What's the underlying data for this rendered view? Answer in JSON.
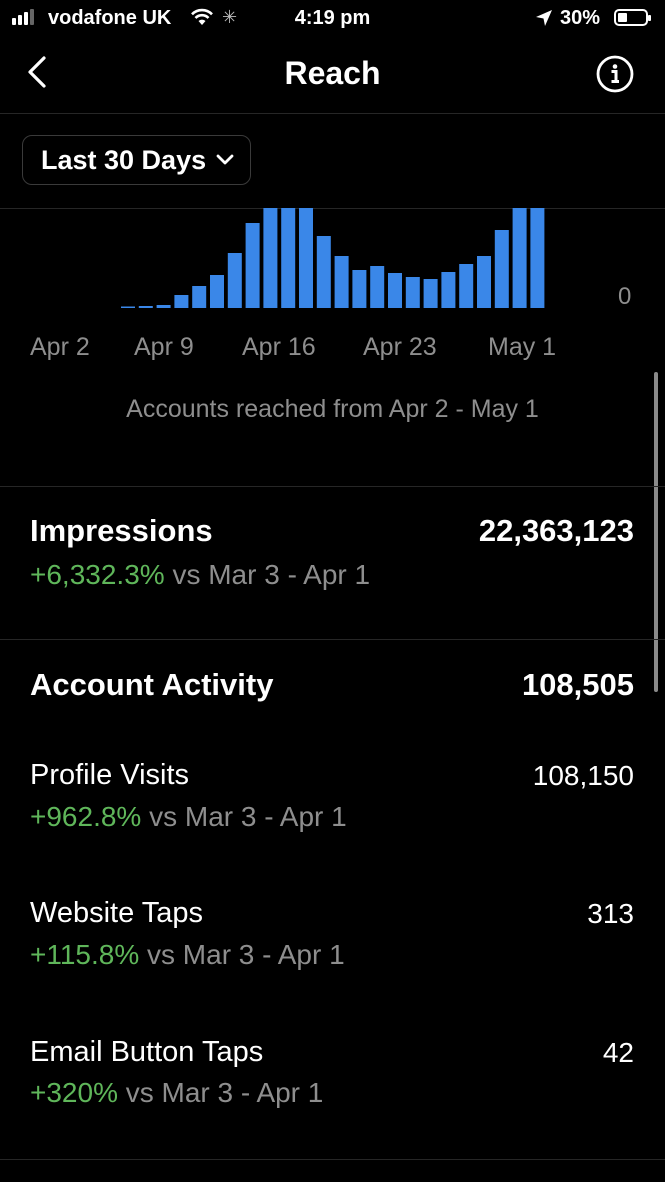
{
  "status_bar": {
    "carrier": "vodafone UK",
    "time": "4:19 pm",
    "battery": "30%"
  },
  "nav": {
    "title": "Reach",
    "back_icon": "chevron-left-icon",
    "info_icon": "info-circle-icon"
  },
  "filter": {
    "label": "Last 30 Days",
    "icon": "chevron-down-icon"
  },
  "chart_data": {
    "type": "bar",
    "color": "#3a87e8",
    "x_tick_labels": [
      "Apr 2",
      "Apr 9",
      "Apr 16",
      "Apr 23",
      "May 1"
    ],
    "y_tick_label": "0",
    "values": [
      1,
      2,
      3,
      13,
      22,
      33,
      55,
      85,
      100,
      100,
      100,
      72,
      52,
      38,
      42,
      35,
      31,
      29,
      36,
      44,
      52,
      78,
      100,
      100
    ],
    "note": "relative heights; top bars clipped at chart top"
  },
  "caption": "Accounts reached from Apr 2 - May 1",
  "impressions": {
    "title": "Impressions",
    "value": "22,363,123",
    "change": "+6,332.3%",
    "compare": " vs Mar 3 - Apr 1"
  },
  "account_activity": {
    "title": "Account Activity",
    "value": "108,505",
    "items": [
      {
        "label": "Profile Visits",
        "value": "108,150",
        "change": "+962.8%",
        "compare": " vs Mar 3 - Apr 1"
      },
      {
        "label": "Website Taps",
        "value": "313",
        "change": "+115.8%",
        "compare": " vs Mar 3 - Apr 1"
      },
      {
        "label": "Email Button Taps",
        "value": "42",
        "change": "+320%",
        "compare": " vs Mar 3 - Apr 1"
      }
    ]
  },
  "colors": {
    "background": "#000000",
    "positive": "#5fb65a",
    "muted": "#8e8e8e",
    "bar": "#3a87e8"
  }
}
